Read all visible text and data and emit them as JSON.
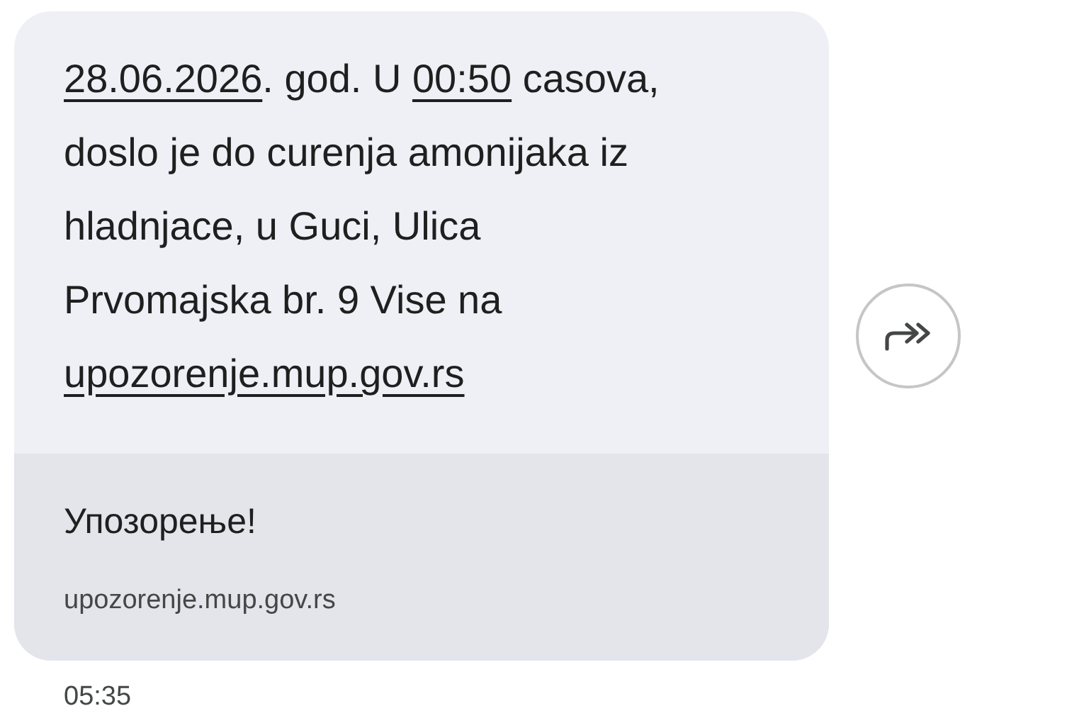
{
  "message": {
    "segments": [
      {
        "kind": "link",
        "text": "28.06.2026"
      },
      {
        "kind": "text",
        "text": ". god. U "
      },
      {
        "kind": "link",
        "text": "00:50"
      },
      {
        "kind": "text",
        "text": " casova, doslo je do curenja amonijaka iz hladnjace, u Guci, Ulica Prvomajska br. 9 Vise na "
      },
      {
        "kind": "link",
        "text": "upozorenje.mup.gov.rs"
      }
    ]
  },
  "preview": {
    "title": "Упозорење!",
    "url": "upozorenje.mup.gov.rs"
  },
  "time": "05:35"
}
